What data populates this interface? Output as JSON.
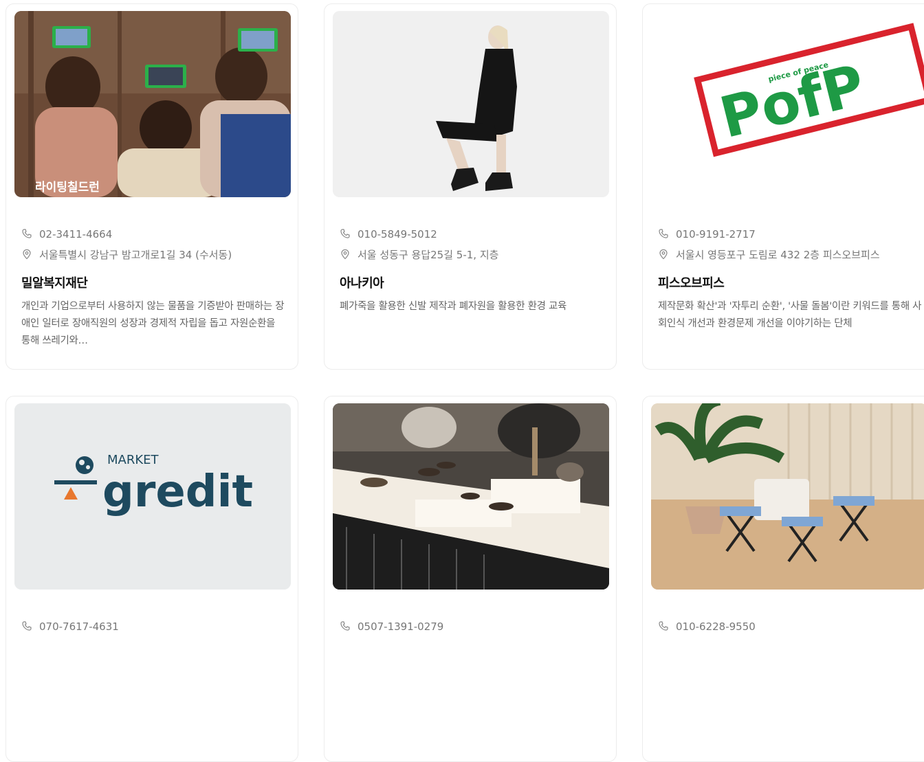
{
  "cards": [
    {
      "phone": "02-3411-4664",
      "address": "서울특별시 강남구 밤고개로1길 34 (수서동)",
      "name": "밀알복지재단",
      "description": "개인과 기업으로부터 사용하지 않는 물품을 기증받아 판매하는 장애인 일터로 장애직원의 성장과 경제적 자립을 돕고 자원순환을 통해 쓰레기와…",
      "image_caption": "라이팅칠드런"
    },
    {
      "phone": "010-5849-5012",
      "address": "서울 성동구 용답25길 5-1, 지층",
      "name": "아나키아",
      "description": "폐가죽을 활용한 신발 제작과 폐자원을 활용한 환경 교육"
    },
    {
      "phone": "010-9191-2717",
      "address": "서울시 영등포구 도림로 432 2층 피스오브피스",
      "name": "피스오브피스",
      "description": "제작문화 확산'과 '자투리 순환', '사물 돌봄'이란 키워드를 통해 사회인식 개선과 환경문제 개선을 이야기하는 단체",
      "logo_text": "PofP",
      "logo_small_text": "piece of peace"
    },
    {
      "phone": "070-7617-4631",
      "logo_text": "gredit",
      "logo_small_text": "MARKET"
    },
    {
      "phone": "0507-1391-0279"
    },
    {
      "phone": "010-6228-9550"
    }
  ],
  "colors": {
    "pofp_green": "#1e9a45",
    "pofp_red": "#d9232d",
    "gredit_navy": "#1e4a5f",
    "gredit_orange": "#e8772e"
  },
  "icons": {
    "phone": "phone-icon",
    "location": "location-pin-icon"
  }
}
